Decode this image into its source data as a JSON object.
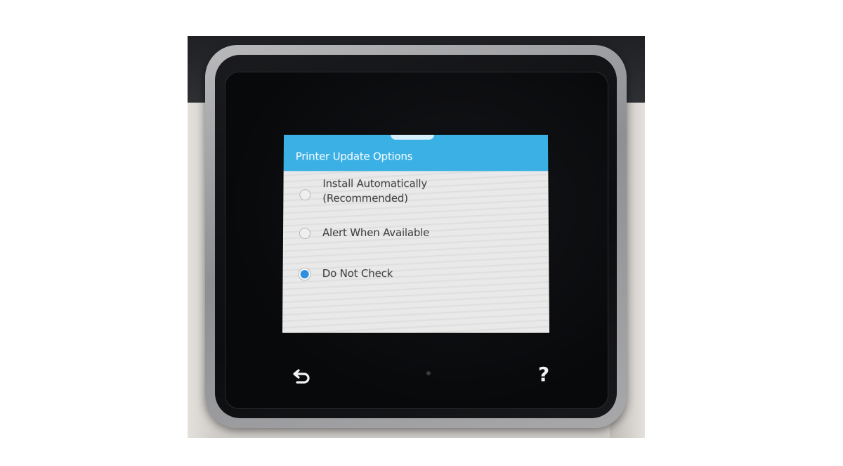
{
  "screen": {
    "title": "Printer Update Options",
    "accent_color": "#3ab0e5",
    "options": [
      {
        "label_line1": "Install Automatically",
        "label_line2": "(Recommended)",
        "selected": false
      },
      {
        "label": "Alert When Available",
        "selected": false
      },
      {
        "label": "Do Not Check",
        "selected": true
      }
    ]
  },
  "bezel_controls": {
    "back_icon": "back-arrow-icon",
    "help_label": "?",
    "help_icon": "help-icon"
  }
}
